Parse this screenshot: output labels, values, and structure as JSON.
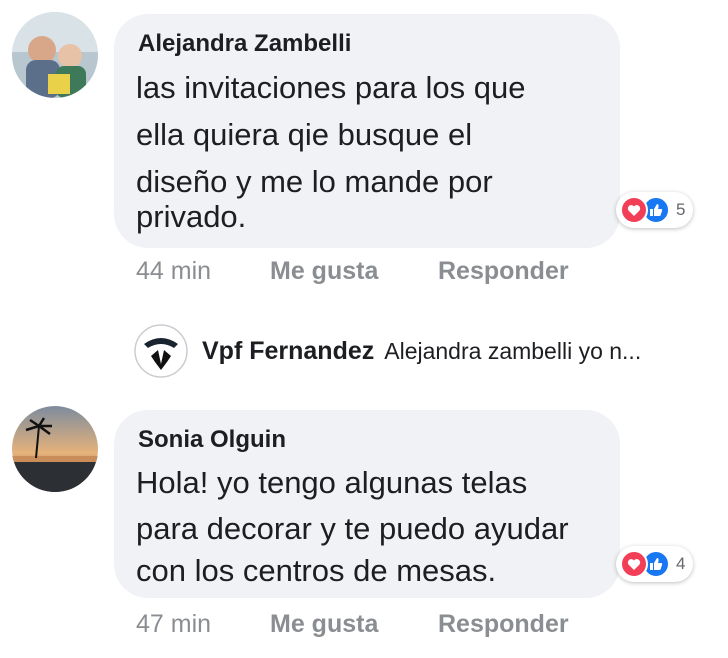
{
  "comments": [
    {
      "author": "Alejandra Zambelli",
      "lines": [
        "las invitaciones para los que",
        "ella quiera qie busque el",
        "diseño y me lo mande por",
        "privado."
      ],
      "reaction_count": "5",
      "time": "44 min",
      "like_label": "Me gusta",
      "reply_label": "Responder"
    },
    {
      "author": "Sonia Olguin",
      "lines": [
        "Hola! yo tengo algunas telas",
        "para decorar y te puedo ayudar",
        "con los centros de mesas."
      ],
      "reaction_count": "4",
      "time": "47 min",
      "like_label": "Me gusta",
      "reply_label": "Responder"
    }
  ],
  "reply_preview": {
    "author": "Vpf Fernandez",
    "snippet": "Alejandra zambelli yo n..."
  },
  "colors": {
    "bubble": "#f0f2f5",
    "love": "#f33e58",
    "like": "#1877f2",
    "meta": "#8a8d91"
  }
}
